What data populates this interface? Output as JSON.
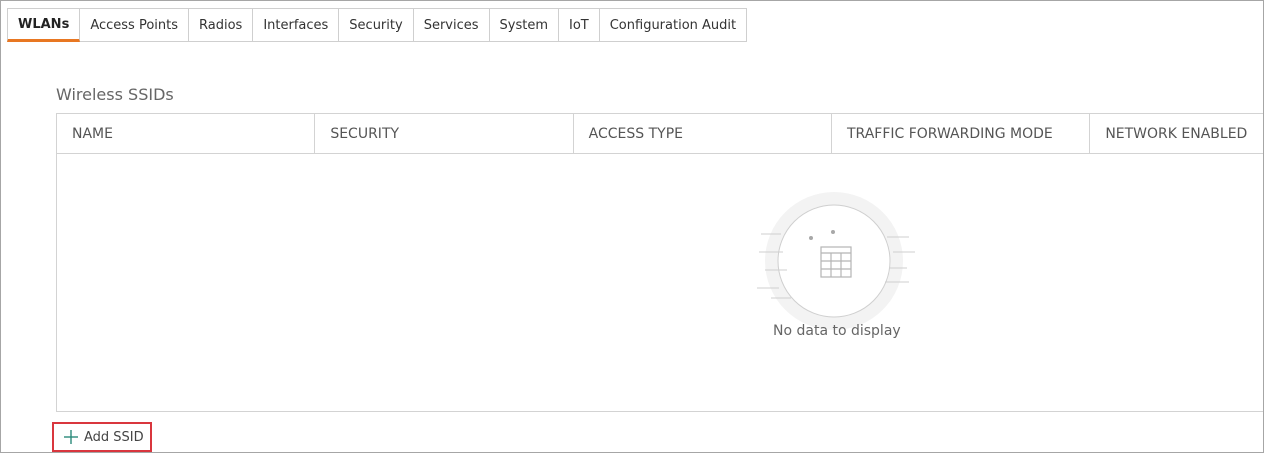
{
  "tabs": [
    {
      "label": "WLANs",
      "active": true
    },
    {
      "label": "Access Points"
    },
    {
      "label": "Radios"
    },
    {
      "label": "Interfaces"
    },
    {
      "label": "Security"
    },
    {
      "label": "Services"
    },
    {
      "label": "System"
    },
    {
      "label": "IoT"
    },
    {
      "label": "Configuration Audit"
    }
  ],
  "section": {
    "title": "Wireless SSIDs"
  },
  "table": {
    "columns": [
      "NAME",
      "SECURITY",
      "ACCESS TYPE",
      "TRAFFIC FORWARDING MODE",
      "NETWORK ENABLED"
    ],
    "rows": [],
    "empty_text": "No data to display"
  },
  "actions": {
    "add_ssid_label": "Add SSID"
  },
  "icons": {
    "add": "plus-icon",
    "empty": "empty-table-icon"
  },
  "colors": {
    "active_tab_underline": "#e87722",
    "highlight_border": "#d9363e",
    "plus_color": "#2a8a7a"
  }
}
